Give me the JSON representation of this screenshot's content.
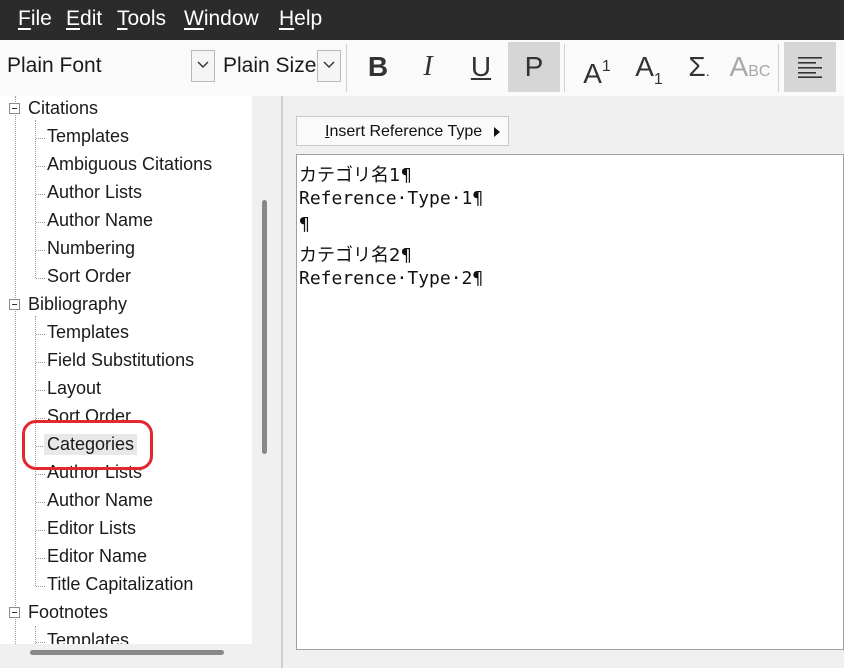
{
  "menu": [
    {
      "label": "File",
      "key": "F",
      "rest": "ile"
    },
    {
      "label": "Edit",
      "key": "E",
      "rest": "dit"
    },
    {
      "label": "Tools",
      "key": "T",
      "rest": "ools"
    },
    {
      "label": "Window",
      "key": "W",
      "rest": "indow"
    },
    {
      "label": "Help",
      "key": "H",
      "rest": "elp"
    }
  ],
  "toolbar": {
    "font": "Plain Font",
    "size": "Plain Size",
    "bold": "B",
    "italic": "I",
    "underline": "U",
    "plain": "P",
    "superscript_base": "A",
    "superscript_mark": "1",
    "subscript_base": "A",
    "subscript_mark": "1",
    "symbol": "Σ",
    "smallcaps_big": "A",
    "smallcaps_small": "BC"
  },
  "tree": {
    "citations": "Citations",
    "citations_children": [
      "Templates",
      "Ambiguous Citations",
      "Author Lists",
      "Author Name",
      "Numbering",
      "Sort Order"
    ],
    "bibliography": "Bibliography",
    "bibliography_children": [
      "Templates",
      "Field Substitutions",
      "Layout",
      "Sort Order",
      "Categories",
      "Author Lists",
      "Author Name",
      "Editor Lists",
      "Editor Name",
      "Title Capitalization"
    ],
    "footnotes": "Footnotes",
    "footnotes_children": [
      "Templates"
    ]
  },
  "insert_button": {
    "label": "Insert Reference Type",
    "key": "I",
    "rest": "nsert Reference Type"
  },
  "editor_lines": [
    "カテゴリ名1¶",
    "Reference·Type·1¶",
    "¶",
    "カテゴリ名2¶",
    "Reference·Type·2¶"
  ]
}
